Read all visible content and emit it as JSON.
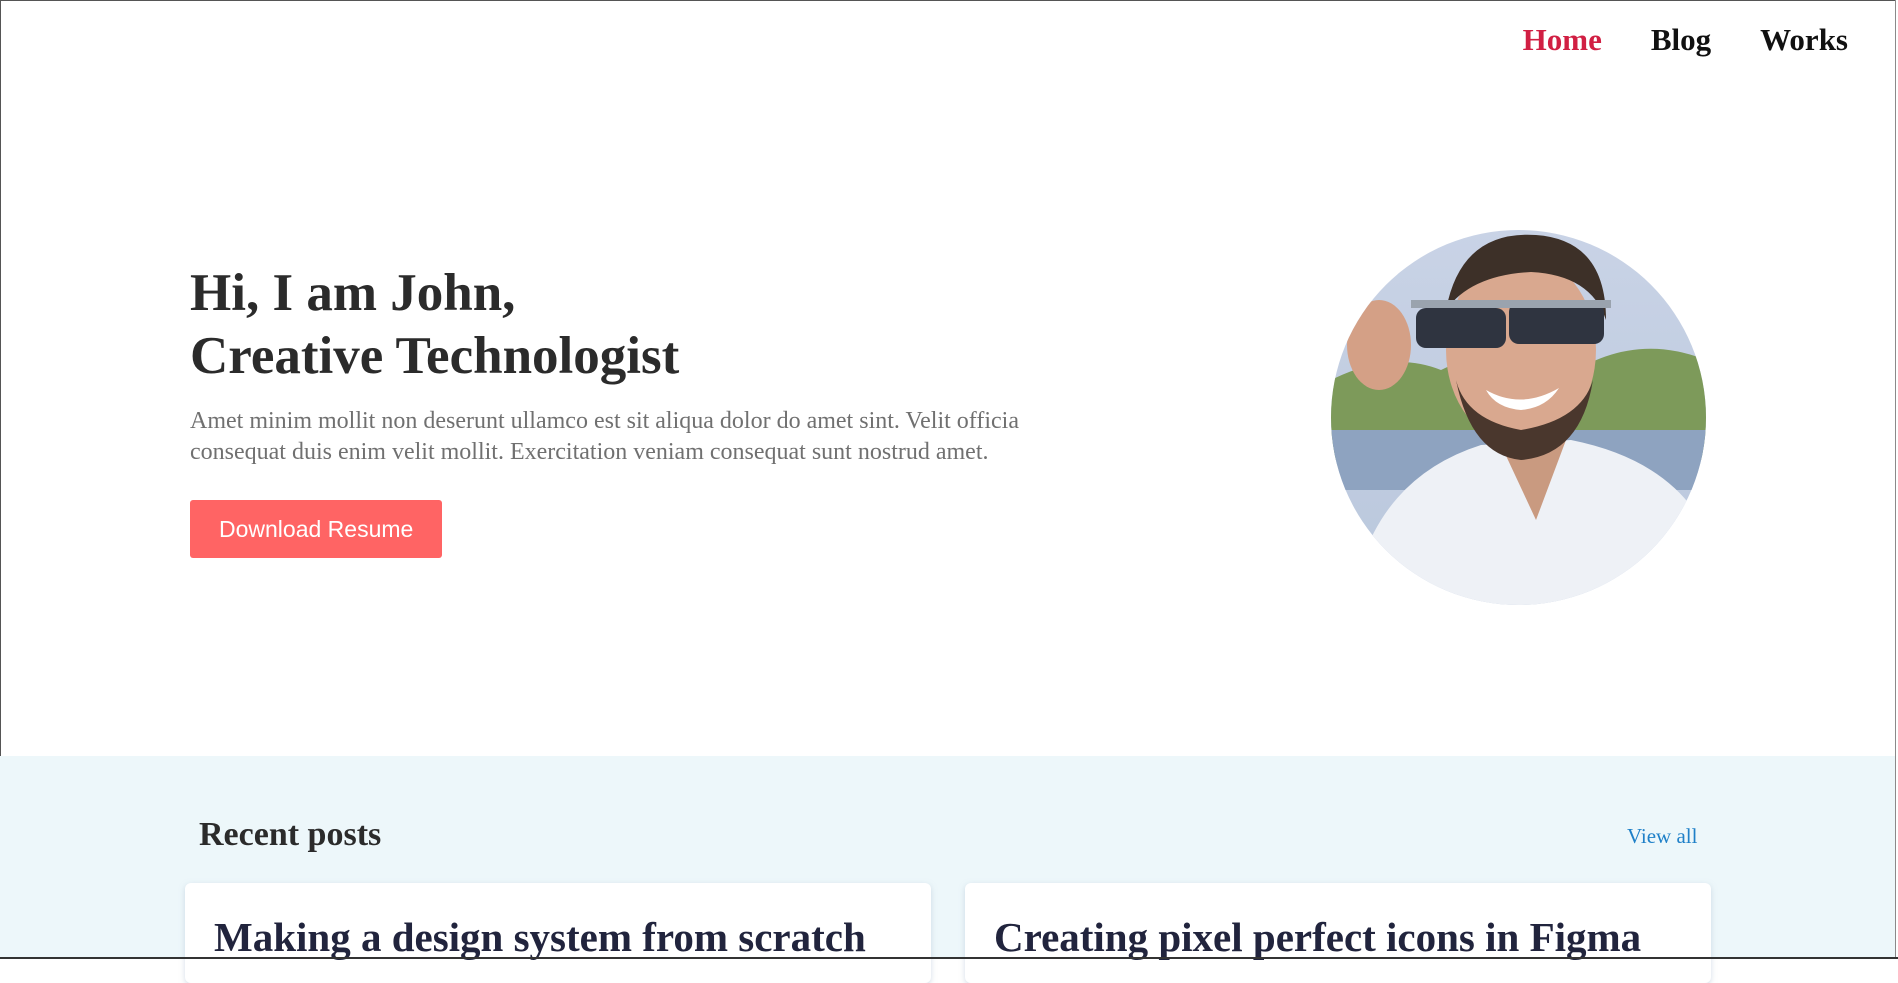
{
  "nav": {
    "items": [
      {
        "label": "Home",
        "active": true
      },
      {
        "label": "Blog",
        "active": false
      },
      {
        "label": "Works",
        "active": false
      }
    ],
    "active_color": "#d11f43"
  },
  "hero": {
    "line1": "Hi, I am John,",
    "line2": "Creative Technologist",
    "description": "Amet minim mollit non deserunt ullamco est sit aliqua dolor do amet sint. Velit officia consequat duis enim velit mollit. Exercitation veniam consequat sunt nostrud amet.",
    "button_label": "Download Resume",
    "button_color": "#ff6464"
  },
  "profile_image": {
    "icon": "profile-photo",
    "alt": "Smiling man with sunglasses in a white shirt"
  },
  "recent_posts": {
    "title": "Recent posts",
    "view_all": "View all",
    "background": "#edf7fa",
    "posts": [
      {
        "title": "Making a design system from scratch"
      },
      {
        "title": "Creating pixel perfect icons in Figma"
      }
    ]
  }
}
